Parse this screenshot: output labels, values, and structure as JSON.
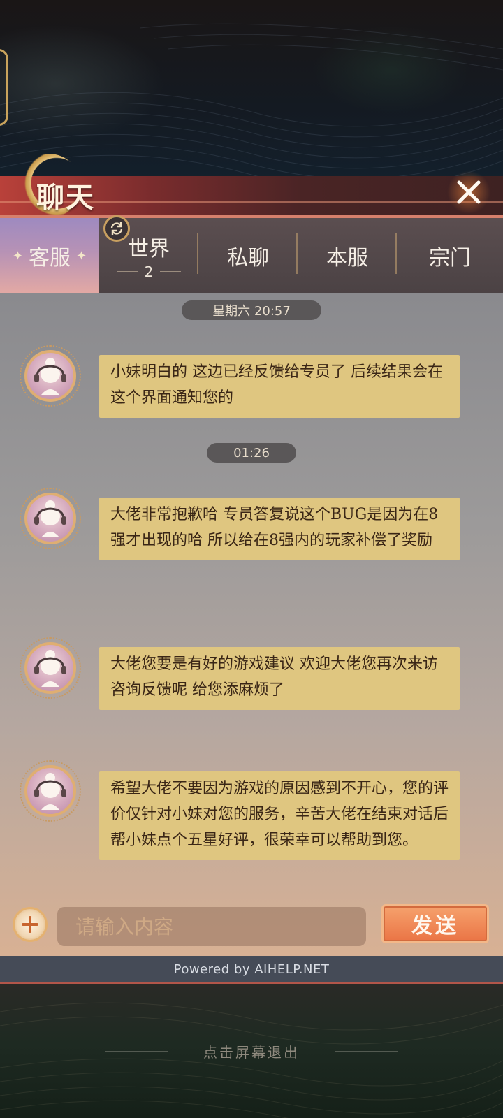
{
  "header": {
    "title": "聊天"
  },
  "tabs": [
    {
      "label": "客服",
      "active": true
    },
    {
      "label": "世界",
      "count": "2"
    },
    {
      "label": "私聊"
    },
    {
      "label": "本服"
    },
    {
      "label": "宗门"
    }
  ],
  "messages": [
    {
      "time": "星期六 20:57",
      "text": "小妹明白的 这边已经反馈给专员了 后续结果会在这个界面通知您的"
    },
    {
      "time": "01:26",
      "text": "大佬非常抱歉哈 专员答复说这个BUG是因为在8强才出现的哈 所以给在8强内的玩家补偿了奖励"
    },
    {
      "text": "大佬您要是有好的游戏建议 欢迎大佬您再次来访咨询反馈呢 给您添麻烦了"
    },
    {
      "text": "希望大佬不要因为游戏的原因感到不开心，您的评价仅针对小妹对您的服务，辛苦大佬在结束对话后帮小妹点个五星好评，很荣幸可以帮助到您。"
    }
  ],
  "input": {
    "placeholder": "请输入内容",
    "value": ""
  },
  "send_label": "发送",
  "footer": {
    "powered_by": "Powered by AIHELP.NET",
    "exit_hint": "点击屏幕退出"
  },
  "icons": {
    "close": "close-icon",
    "refresh": "refresh-icon",
    "add": "plus-icon",
    "avatar": "support-agent-avatar"
  },
  "colors": {
    "bubble": "#dfc680",
    "header_red": "#b9413a",
    "active_tab": "#b792b5",
    "send_orange": "#ea7445"
  }
}
